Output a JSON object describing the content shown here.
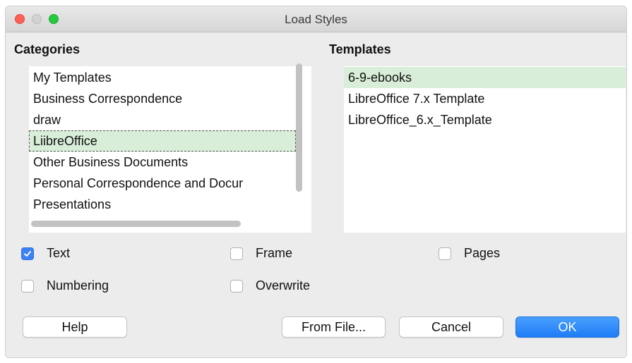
{
  "window": {
    "title": "Load Styles"
  },
  "categories": {
    "label": "Categories",
    "items": [
      "My Templates",
      "Business Correspondence",
      "draw",
      "LiibreOffice",
      "Other Business Documents",
      "Personal Correspondence and Docur",
      "Presentations"
    ],
    "selected": "LiibreOffice"
  },
  "templates": {
    "label": "Templates",
    "items": [
      "6-9-ebooks",
      "LibreOffice 7.x Template",
      "LibreOffice_6.x_Template"
    ],
    "selected": "6-9-ebooks"
  },
  "options": {
    "text": {
      "label": "Text",
      "checked": true
    },
    "frame": {
      "label": "Frame",
      "checked": false
    },
    "pages": {
      "label": "Pages",
      "checked": false
    },
    "numbering": {
      "label": "Numbering",
      "checked": false
    },
    "overwrite": {
      "label": "Overwrite",
      "checked": false
    }
  },
  "buttons": {
    "help": "Help",
    "from_file": "From File...",
    "cancel": "Cancel",
    "ok": "OK"
  },
  "colors": {
    "selection": "#d8eed8",
    "accent": "#1f7cf5"
  }
}
